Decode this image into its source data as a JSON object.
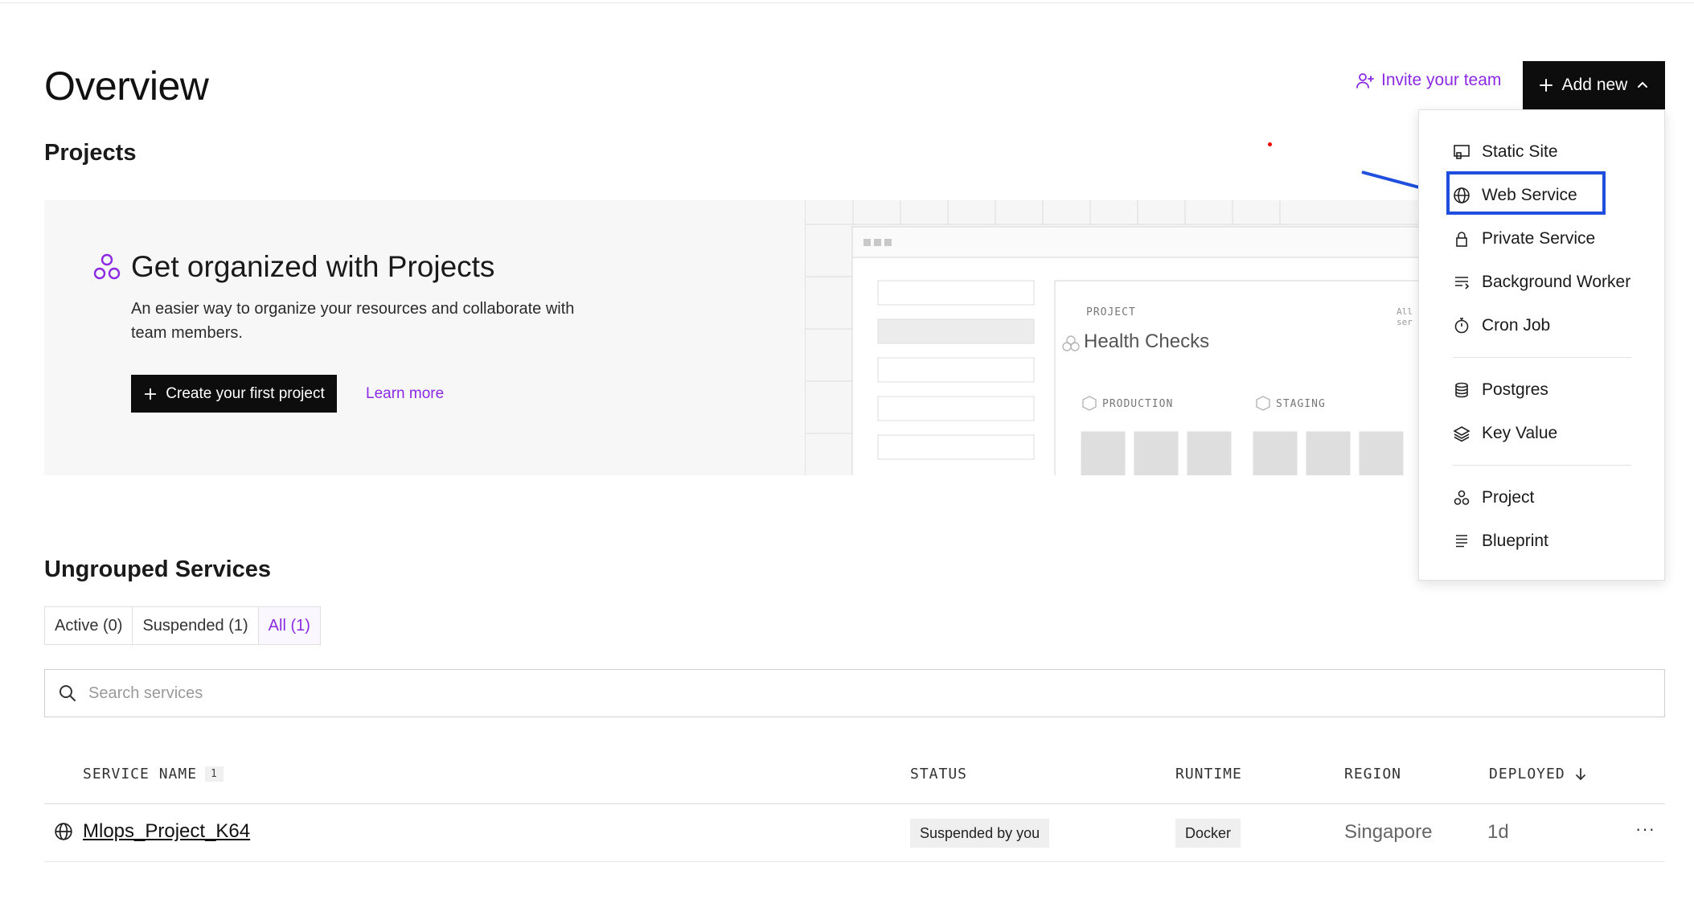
{
  "header": {
    "title": "Overview",
    "invite_label": "Invite your team",
    "add_new_label": "Add new"
  },
  "projects": {
    "heading": "Projects",
    "card_title": "Get organized with Projects",
    "card_desc": "An easier way to organize your resources and collaborate with team members.",
    "create_label": "Create your first project",
    "learn_more": "Learn more",
    "illustration": {
      "project_label": "PROJECT",
      "project_name": "Health Checks",
      "all_label": "All ser",
      "env_production": "PRODUCTION",
      "env_staging": "STAGING"
    }
  },
  "add_menu": {
    "items": [
      {
        "label": "Static Site",
        "icon": "static-site-icon"
      },
      {
        "label": "Web Service",
        "icon": "globe-icon"
      },
      {
        "label": "Private Service",
        "icon": "lock-icon"
      },
      {
        "label": "Background Worker",
        "icon": "worker-icon"
      },
      {
        "label": "Cron Job",
        "icon": "stopwatch-icon"
      },
      {
        "label": "Postgres",
        "icon": "database-icon"
      },
      {
        "label": "Key Value",
        "icon": "layers-icon"
      },
      {
        "label": "Project",
        "icon": "project-icon"
      },
      {
        "label": "Blueprint",
        "icon": "blueprint-icon"
      }
    ],
    "highlighted": "Web Service"
  },
  "ungrouped": {
    "heading": "Ungrouped Services",
    "filters": [
      {
        "label": "Active (0)"
      },
      {
        "label": "Suspended (1)"
      },
      {
        "label": "All (1)"
      }
    ],
    "active_filter": "All (1)",
    "search_placeholder": "Search services",
    "columns": {
      "name": "SERVICE NAME",
      "name_count": "1",
      "status": "STATUS",
      "runtime": "RUNTIME",
      "region": "REGION",
      "deployed": "DEPLOYED"
    },
    "rows": [
      {
        "name": "Mlops_Project_K64",
        "status": "Suspended by you",
        "runtime": "Docker",
        "region": "Singapore",
        "deployed": "1d"
      }
    ]
  },
  "colors": {
    "accent": "#8a2be2",
    "highlight": "#1f4fdc",
    "button_bg": "#0d0d0d"
  }
}
